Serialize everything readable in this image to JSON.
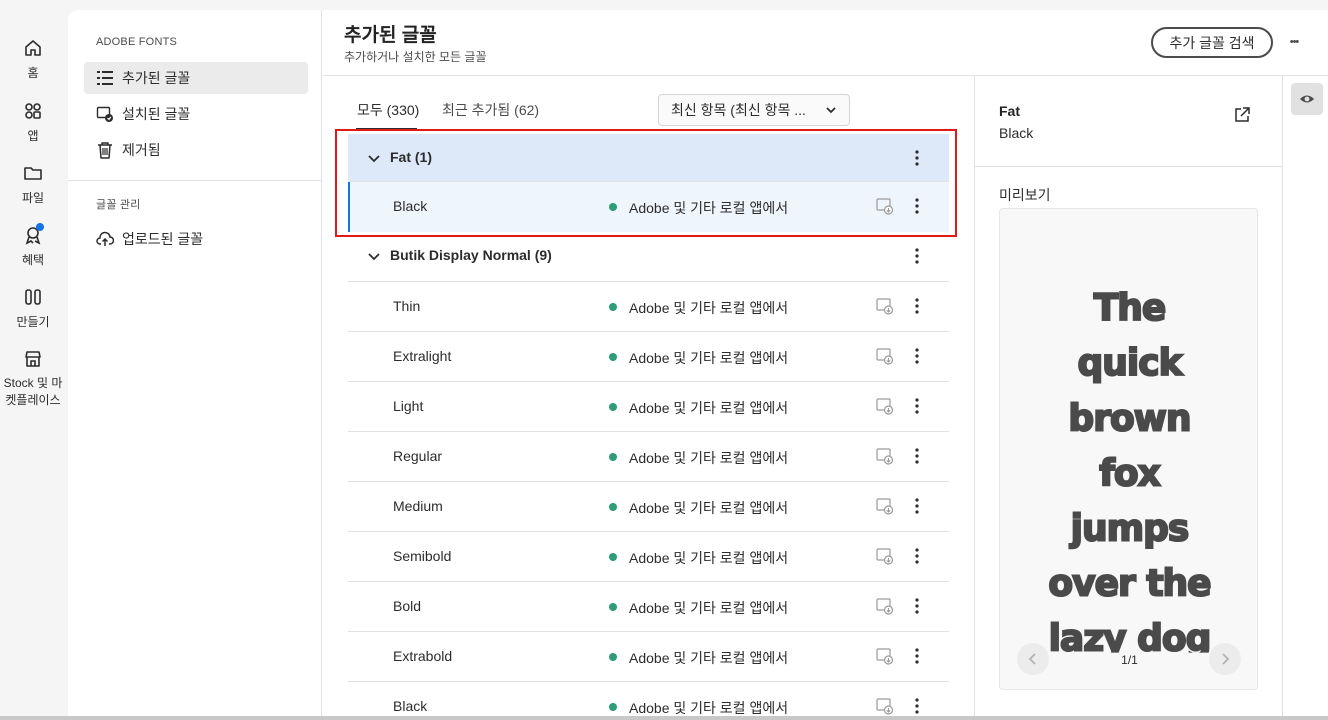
{
  "rail": {
    "items": [
      {
        "label": "홈",
        "icon": "home-icon"
      },
      {
        "label": "앱",
        "icon": "apps-icon"
      },
      {
        "label": "파일",
        "icon": "folder-icon"
      },
      {
        "label": "혜택",
        "icon": "perks-icon"
      },
      {
        "label": "만들기",
        "icon": "create-icon"
      },
      {
        "label_line1": "Stock 및 마",
        "label_line2": "켓플레이스",
        "icon": "stock-icon"
      }
    ],
    "badge_color": "#1473e6"
  },
  "sidenav": {
    "section_title": "ADOBE FONTS",
    "items": [
      {
        "label": "추가된 글꼴",
        "icon": "list-icon",
        "active": true
      },
      {
        "label": "설치된 글꼴",
        "icon": "installed-icon"
      },
      {
        "label": "제거됨",
        "icon": "trash-icon"
      }
    ],
    "manage_title": "글꼴 관리",
    "manage_items": [
      {
        "label": "업로드된 글꼴",
        "icon": "upload-cloud-icon"
      }
    ]
  },
  "header": {
    "title": "추가된 글꼴",
    "subtitle": "추가하거나 설치한 모든 글꼴",
    "search_button": "추가 글꼴 검색",
    "more": "•••"
  },
  "tabs": [
    {
      "label": "모두 (330)",
      "active": true
    },
    {
      "label": "최근 추가됨 (62)",
      "active": false
    }
  ],
  "sort": {
    "value": "최신 항목 (최신 항목 ..."
  },
  "list": {
    "groups": [
      {
        "name": "Fat (1)",
        "styles": [
          "Black"
        ]
      },
      {
        "name": "Butik Display Normal (9)",
        "styles": [
          "Thin",
          "Extralight",
          "Light",
          "Regular",
          "Medium",
          "Semibold",
          "Bold",
          "Extrabold",
          "Black"
        ]
      }
    ],
    "status_text": "Adobe 및 기타 로컬 앱에서",
    "status_color": "#2d9d78",
    "selection_color": "#1473e6",
    "highlight_color": "#e01919"
  },
  "detail": {
    "font_name": "Fat",
    "style": "Black",
    "preview_label": "미리보기",
    "preview_lines": [
      "The",
      "quick",
      "brown",
      "fox",
      "jumps",
      "over the",
      "lazy dog"
    ],
    "page_count": "1/1"
  }
}
